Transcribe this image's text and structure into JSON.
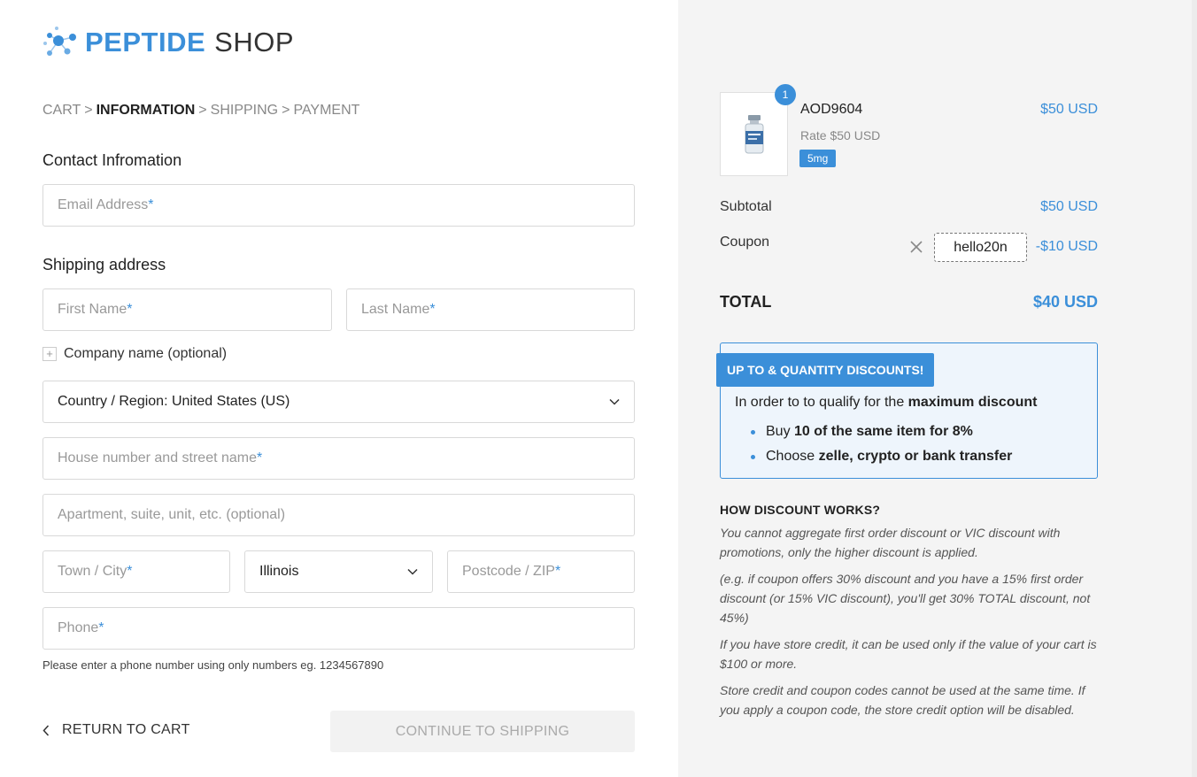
{
  "brand": {
    "name_a": "PEPTIDE",
    "name_b": "SHOP",
    "accent": "#3b8fd9",
    "logo_icon": "molecule-icon"
  },
  "breadcrumb": {
    "cart": "CART",
    "sep1": ">",
    "information": "INFORMATION",
    "sep2": ">",
    "shipping": "SHIPPING",
    "sep3": ">",
    "payment": "PAYMENT"
  },
  "contact": {
    "title": "Contact Infromation",
    "email_placeholder": "Email Address",
    "required_mark": "*"
  },
  "shipping": {
    "title": "Shipping address",
    "first_name": "First Name",
    "last_name": "Last Name",
    "company_toggle": "Company name (optional)",
    "country": "Country / Region: United States (US)",
    "street": "House number and street name",
    "apartment": "Apartment, suite, unit, etc. (optional)",
    "city": "Town / City",
    "state": "Illinois",
    "zip": "Postcode / ZIP",
    "phone": "Phone",
    "phone_hint": "Please enter a phone number using only numbers eg. 1234567890"
  },
  "actions": {
    "return": "RETURN TO CART",
    "continue": "CONTINUE TO SHIPPING"
  },
  "order": {
    "item": {
      "qty": "1",
      "name": "AOD9604",
      "price": "$50 USD",
      "rate": "Rate $50 USD",
      "variant": "5mg"
    },
    "subtotal_label": "Subtotal",
    "subtotal": "$50 USD",
    "coupon_label": "Coupon",
    "coupon_code": "hello20n",
    "coupon_discount": "-$10 USD",
    "total_label": "TOTAL",
    "total": "$40 USD"
  },
  "promo": {
    "tag": "UP TO & QUANTITY DISCOUNTS!",
    "intro": "In order to to qualify for the ",
    "intro_bold": "maximum discount",
    "b1_pre": "Buy ",
    "b1_bold": "10 of the same item for 8%",
    "b2_pre": "Choose ",
    "b2_bold": "zelle, crypto or bank transfer"
  },
  "how": {
    "title": "HOW DISCOUNT WORKS?",
    "p1": "You cannot aggregate first order discount or VIC discount with promotions, only the higher discount is applied.",
    "p2": "(e.g. if coupon offers 30% discount and you have a 15% first order discount (or 15% VIC discount), you'll get 30% TOTAL discount, not 45%)",
    "p3": "If you have store credit, it can be used only if the value of your cart is $100 or more.",
    "p4": "Store credit and coupon codes cannot be used at the same time. If you apply a coupon code, the store credit option will be disabled."
  }
}
